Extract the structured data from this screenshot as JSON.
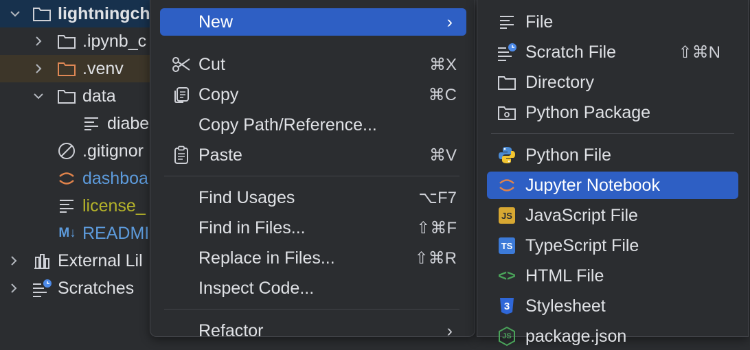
{
  "tree": {
    "items": [
      {
        "label": "lightningch",
        "chev": "down",
        "icon": "folder-icon"
      },
      {
        "label": ".ipynb_c",
        "chev": "right",
        "icon": "folder-icon"
      },
      {
        "label": ".venv",
        "chev": "right",
        "icon": "folder-icon"
      },
      {
        "label": "data",
        "chev": "down",
        "icon": "folder-icon"
      },
      {
        "label": "diabe",
        "chev": "",
        "icon": "text-file-icon"
      },
      {
        "label": ".gitignor",
        "chev": "",
        "icon": "ignore-file-icon"
      },
      {
        "label": "dashboa",
        "chev": "",
        "icon": "jupyter-icon"
      },
      {
        "label": "license_",
        "chev": "",
        "icon": "text-file-icon"
      },
      {
        "label": "READMI",
        "chev": "",
        "icon": "markdown-icon",
        "icon_text": "M↓"
      },
      {
        "label": "External Lil",
        "chev": "right",
        "icon": "library-icon"
      },
      {
        "label": "Scratches",
        "chev": "right",
        "icon": "scratches-icon"
      }
    ],
    "colors": {
      "venv": "#e08855",
      "dashboard": "#5d9bdc",
      "license": "#b5b32a",
      "readme": "#5d9bdc"
    }
  },
  "menu": {
    "new": {
      "label": "New",
      "arrow": "›"
    },
    "cut": {
      "label": "Cut",
      "shortcut": "⌘X"
    },
    "copy": {
      "label": "Copy",
      "shortcut": "⌘C"
    },
    "copy_path": {
      "label": "Copy Path/Reference..."
    },
    "paste": {
      "label": "Paste",
      "shortcut": "⌘V"
    },
    "find_usages": {
      "label": "Find Usages",
      "shortcut": "⌥F7"
    },
    "find_in_files": {
      "label": "Find in Files...",
      "shortcut": "⇧⌘F"
    },
    "replace_in_files": {
      "label": "Replace in Files...",
      "shortcut": "⇧⌘R"
    },
    "inspect_code": {
      "label": "Inspect Code..."
    },
    "refactor": {
      "label": "Refactor",
      "arrow": "›"
    }
  },
  "submenu": {
    "file": {
      "label": "File"
    },
    "scratch_file": {
      "label": "Scratch File",
      "shortcut": "⇧⌘N"
    },
    "directory": {
      "label": "Directory"
    },
    "python_package": {
      "label": "Python Package"
    },
    "python_file": {
      "label": "Python File"
    },
    "jupyter_notebook": {
      "label": "Jupyter Notebook"
    },
    "javascript_file": {
      "label": "JavaScript File",
      "badge": "JS"
    },
    "typescript_file": {
      "label": "TypeScript File",
      "badge": "TS"
    },
    "html_file": {
      "label": "HTML File",
      "badge": "<>"
    },
    "stylesheet": {
      "label": "Stylesheet",
      "badge": "3"
    },
    "package_json": {
      "label": "package.json",
      "badge": "JS"
    }
  },
  "colors": {
    "accent": "#2e5fc4",
    "js_badge": "#d8a832",
    "ts_badge": "#3c7ad8",
    "css_badge": "#2f67d8",
    "html_badge": "#4aa35a",
    "jupyter": "#e0834b"
  }
}
